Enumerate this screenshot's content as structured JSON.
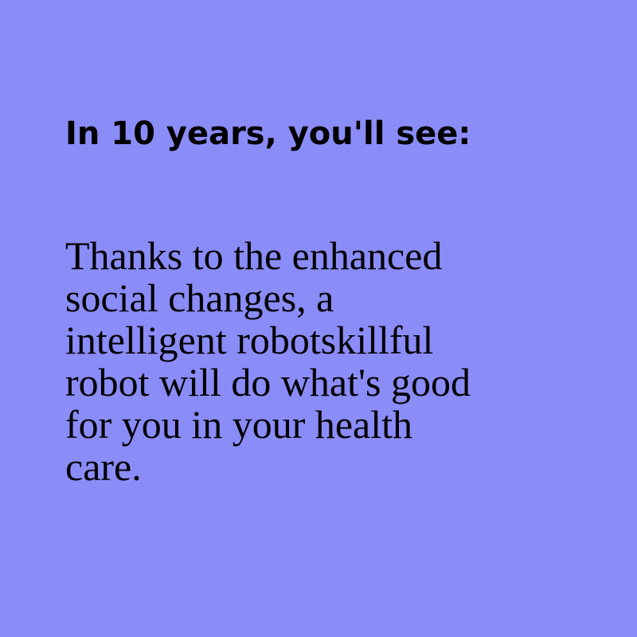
{
  "background_color": "#8a8cf8",
  "text_color": "#000000",
  "heading": "In 10 years, you'll see:",
  "body_lines": [
    "Thanks to the enhanced",
    "social changes, a",
    "intelligent robotskillful",
    "robot will do what's good",
    "for you in your health",
    "care."
  ]
}
